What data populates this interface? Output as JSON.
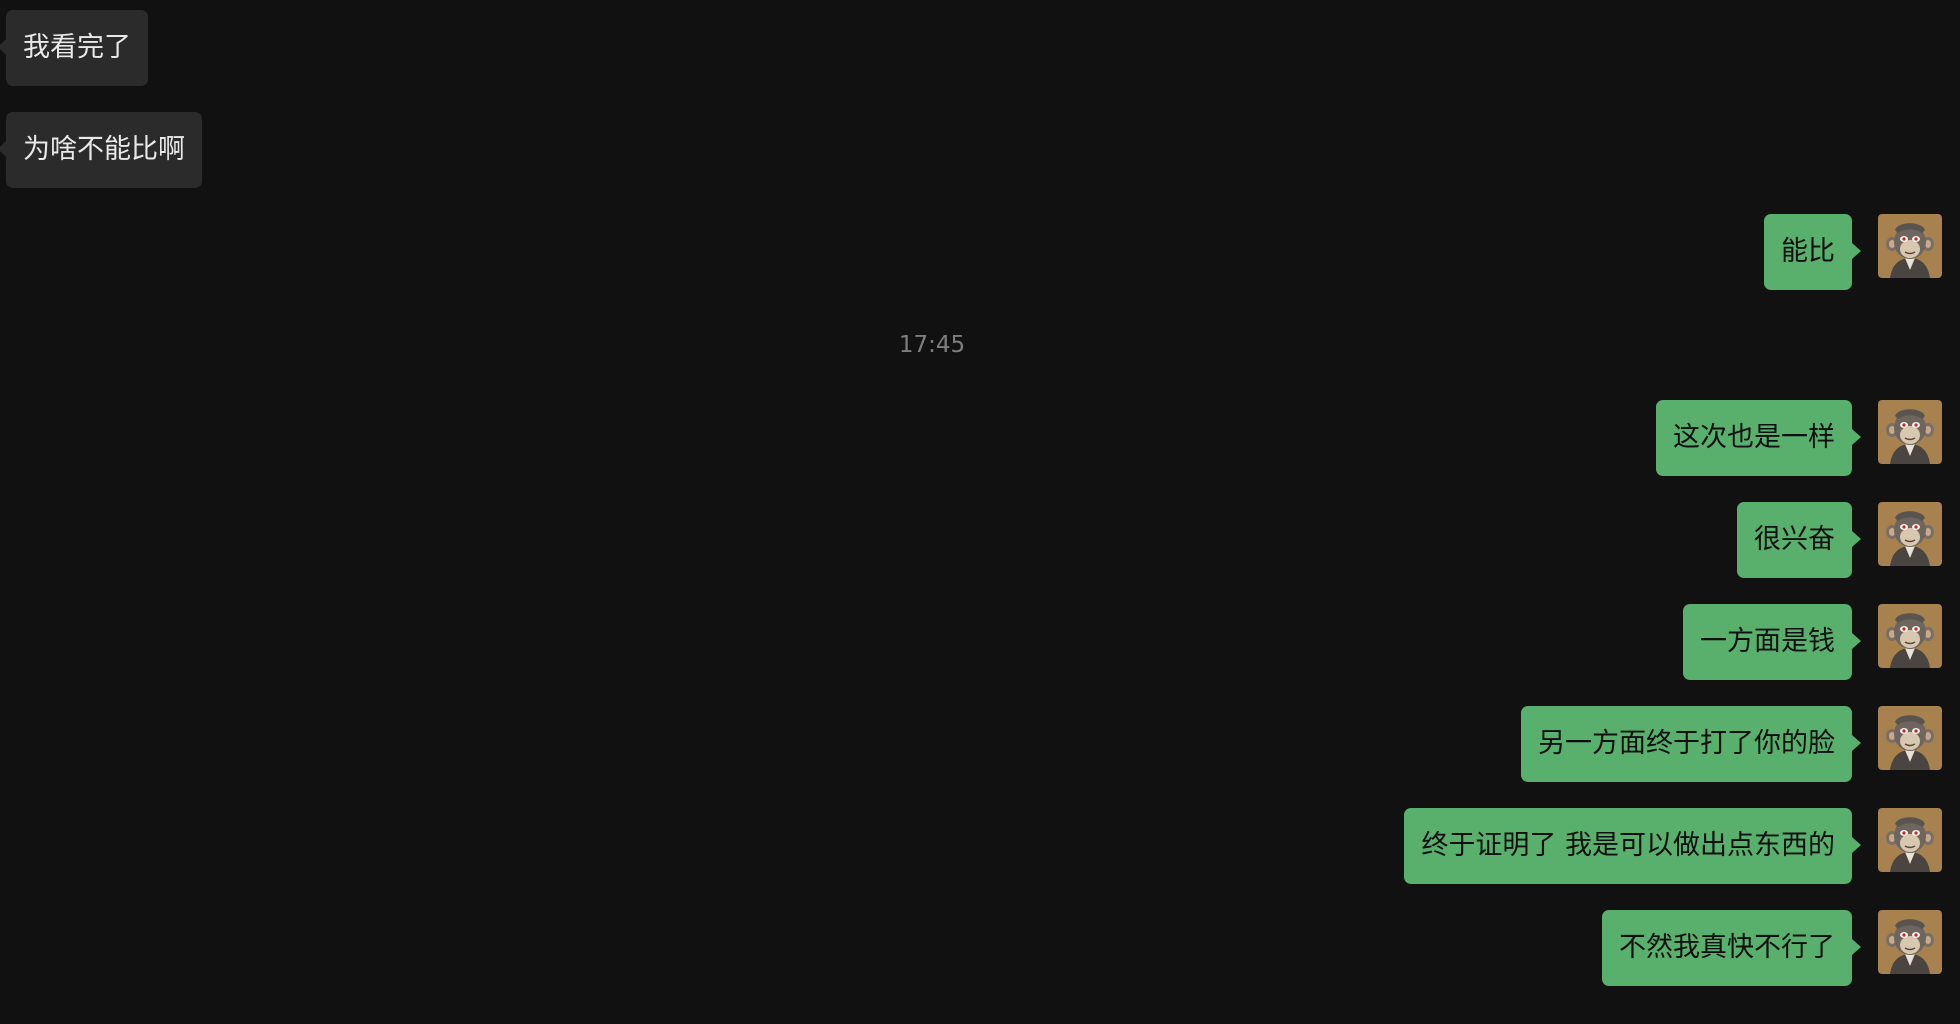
{
  "conversation": {
    "timestamp": "17:45",
    "avatar_icon": "ape-avatar-icon",
    "colors": {
      "background": "#111111",
      "incoming_bubble": "#2b2b2b",
      "outgoing_bubble": "#58b06c",
      "timestamp_text": "#7e7e7e"
    },
    "messages": [
      {
        "direction": "incoming",
        "text": "我看完了"
      },
      {
        "direction": "incoming",
        "text": "为啥不能比啊"
      },
      {
        "direction": "outgoing",
        "text": "能比"
      },
      {
        "direction": "outgoing",
        "text": "这次也是一样"
      },
      {
        "direction": "outgoing",
        "text": "很兴奋"
      },
      {
        "direction": "outgoing",
        "text": "一方面是钱"
      },
      {
        "direction": "outgoing",
        "text": "另一方面终于打了你的脸"
      },
      {
        "direction": "outgoing",
        "text": "终于证明了 我是可以做出点东西的"
      },
      {
        "direction": "outgoing",
        "text": "不然我真快不行了"
      }
    ]
  }
}
